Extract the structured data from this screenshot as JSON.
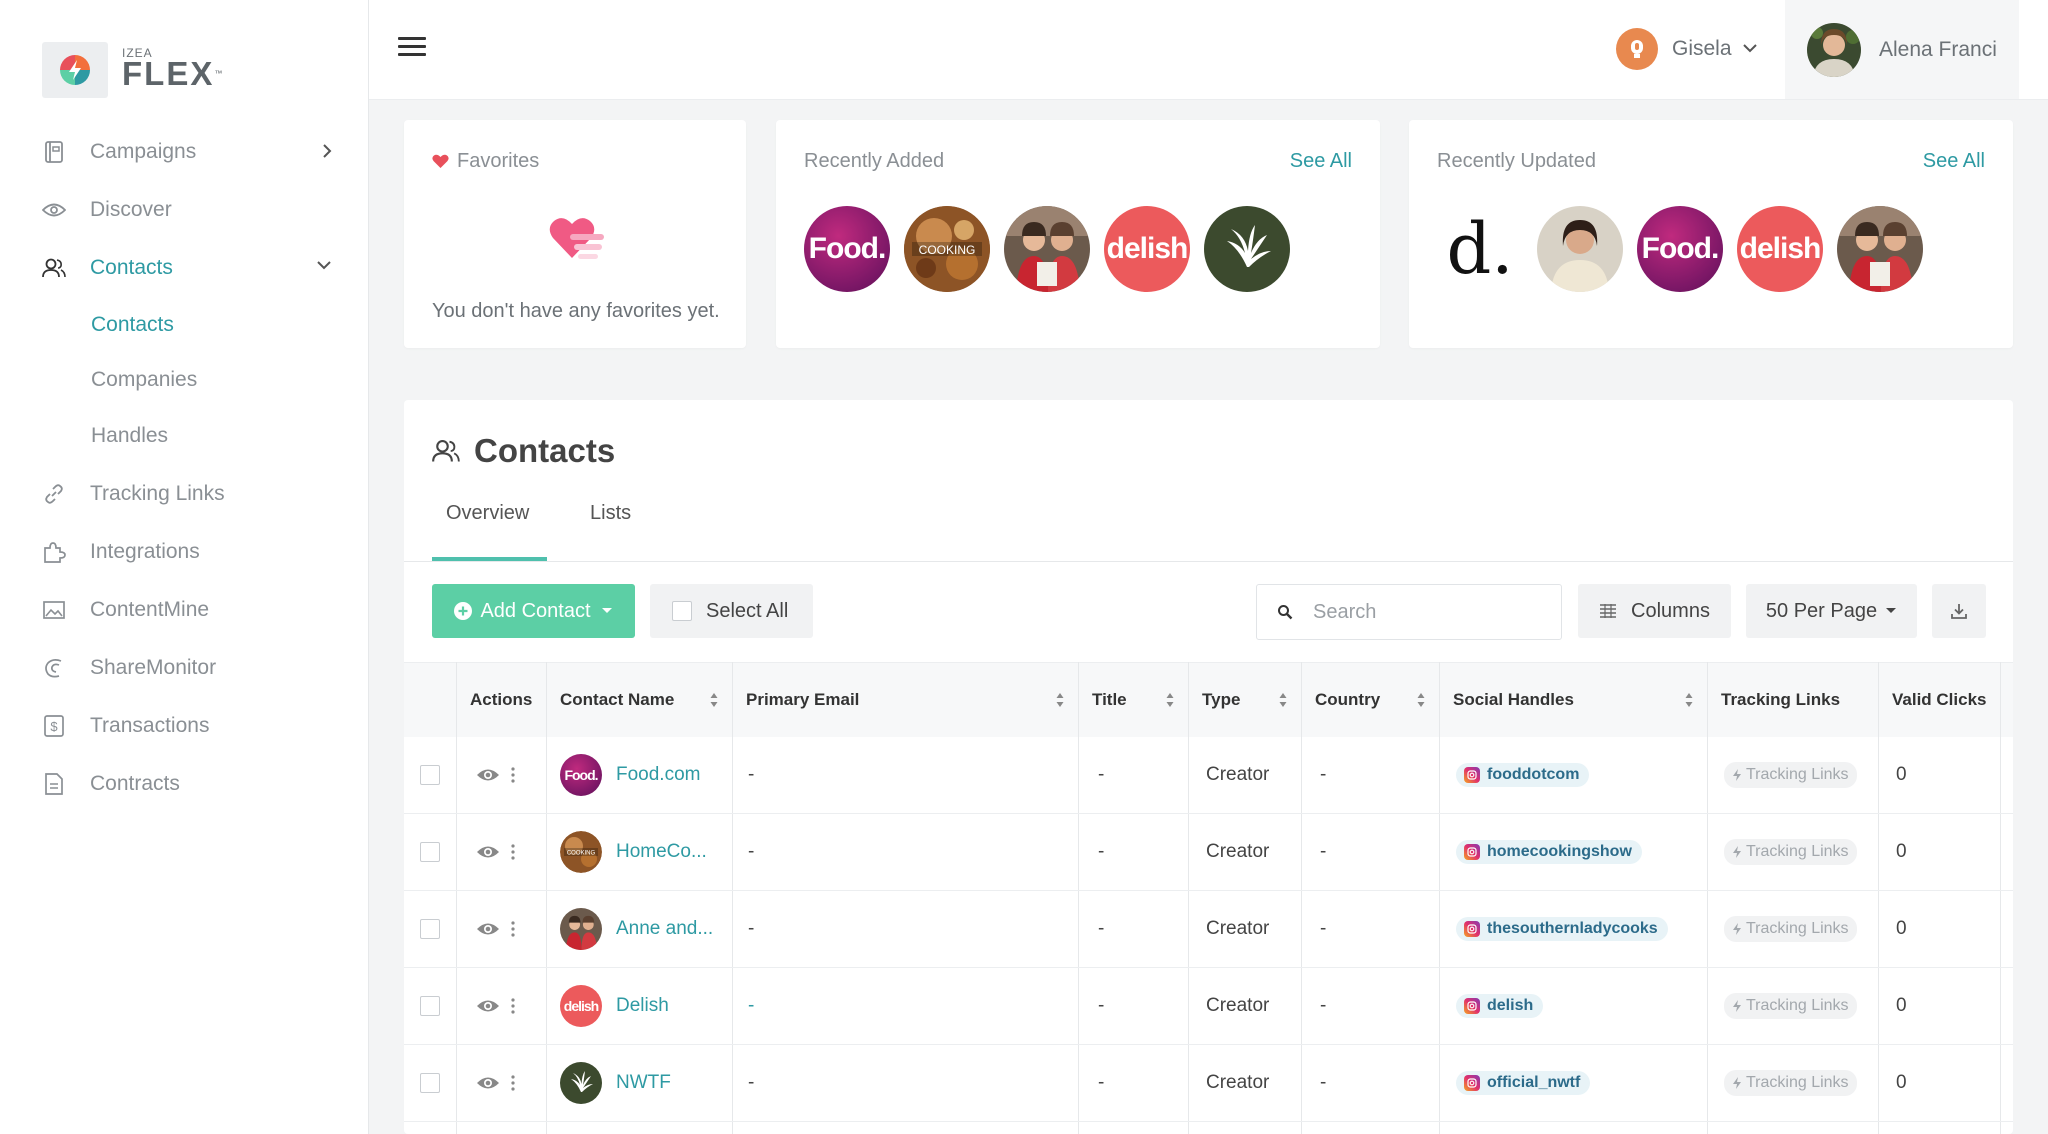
{
  "brand": {
    "small": "IZEA",
    "big": "FLEX",
    "tm": "™"
  },
  "sidebar": {
    "items": [
      {
        "label": "Campaigns",
        "icon": "campaign-icon"
      },
      {
        "label": "Discover",
        "icon": "eye-icon"
      },
      {
        "label": "Contacts",
        "icon": "people-icon"
      },
      {
        "label": "Tracking Links",
        "icon": "link-icon"
      },
      {
        "label": "Integrations",
        "icon": "puzzle-icon"
      },
      {
        "label": "ContentMine",
        "icon": "image-icon"
      },
      {
        "label": "ShareMonitor",
        "icon": "share-monitor-icon"
      },
      {
        "label": "Transactions",
        "icon": "dollar-icon"
      },
      {
        "label": "Contracts",
        "icon": "document-icon"
      }
    ],
    "contacts_sub": [
      "Contacts",
      "Companies",
      "Handles"
    ]
  },
  "header": {
    "account_name": "Gisela",
    "user_name": "Alena Franci"
  },
  "cards": {
    "favorites": {
      "title": "Favorites",
      "empty": "You don't have any favorites yet."
    },
    "recently_added": {
      "title": "Recently Added",
      "see_all": "See All"
    },
    "recently_updated": {
      "title": "Recently Updated",
      "see_all": "See All"
    }
  },
  "panel": {
    "title": "Contacts",
    "tabs": [
      "Overview",
      "Lists"
    ],
    "add_contact": "Add Contact",
    "select_all": "Select All",
    "search_placeholder": "Search",
    "columns": "Columns",
    "per_page": "50 Per Page"
  },
  "table": {
    "headers": [
      "Actions",
      "Contact Name",
      "Primary Email",
      "Title",
      "Type",
      "Country",
      "Social Handles",
      "Tracking Links",
      "Valid Clicks"
    ],
    "rows": [
      {
        "name": "Food.com",
        "email": "-",
        "title": "-",
        "type": "Creator",
        "country": "-",
        "handle": "fooddotcom",
        "tracking": "Tracking Links",
        "clicks": "0"
      },
      {
        "name": "HomeCo...",
        "email": "-",
        "title": "-",
        "type": "Creator",
        "country": "-",
        "handle": "homecookingshow",
        "tracking": "Tracking Links",
        "clicks": "0"
      },
      {
        "name": "Anne and...",
        "email": "-",
        "title": "-",
        "type": "Creator",
        "country": "-",
        "handle": "thesouthernladycooks",
        "tracking": "Tracking Links",
        "clicks": "0"
      },
      {
        "name": "Delish",
        "email": "-",
        "title": "-",
        "type": "Creator",
        "country": "-",
        "handle": "delish",
        "tracking": "Tracking Links",
        "clicks": "0"
      },
      {
        "name": "NWTF",
        "email": "-",
        "title": "-",
        "type": "Creator",
        "country": "-",
        "handle": "official_nwtf",
        "tracking": "Tracking Links",
        "clicks": "0"
      }
    ]
  },
  "avatars": {
    "food": "Food.",
    "delish": "delish",
    "cooking": "COOKING",
    "d": "d."
  },
  "colors": {
    "accent": "#2e9aa3",
    "primary_button": "#5ccfa5",
    "heart": "#e8505b"
  }
}
